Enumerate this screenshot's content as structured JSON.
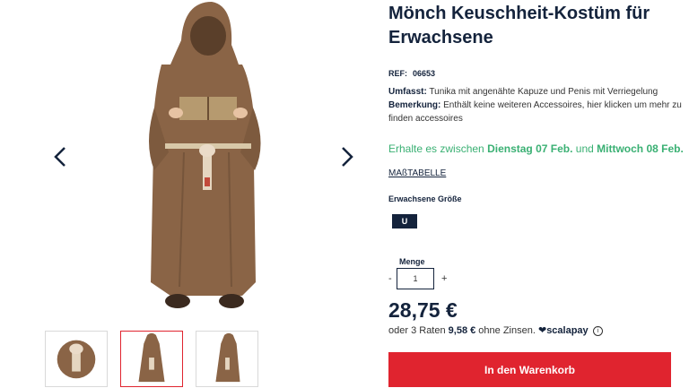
{
  "product": {
    "title": "Mönch Keuschheit-Kostüm für Erwachsene",
    "ref_label": "REF:",
    "ref_value": "06653",
    "umfasst_label": "Umfasst:",
    "umfasst_text": " Tunika mit angenähte Kapuze und Penis mit Verriegelung",
    "bemerkung_label": "Bemerkung:",
    "bemerkung_text": " Enthält keine weiteren Accessoires, hier klicken um mehr zu finden accessoires"
  },
  "delivery": {
    "prefix": "Erhalte es zwischen ",
    "date1": "Dienstag 07 Feb.",
    "middle": " und ",
    "date2": "Mittwoch 08 Feb."
  },
  "size_chart_label": "MAßTABELLE",
  "size": {
    "label": "Erwachsene Größe",
    "selected": "U"
  },
  "quantity": {
    "label": "Menge",
    "value": "1",
    "minus": "-",
    "plus": "+"
  },
  "price": "28,75 €",
  "installment": {
    "prefix": "oder 3 Raten ",
    "amount": "9,58 €",
    "suffix": " ohne Zinsen. ",
    "provider": "scalapay",
    "info": "i"
  },
  "cart_button": "In den Warenkorb",
  "colors": {
    "navy": "#14233c",
    "red": "#e0242f",
    "green": "#3ab073",
    "robe": "#8a6446"
  },
  "icons": {
    "prev": "chevron-left-icon",
    "next": "chevron-right-icon",
    "heart": "heart-icon",
    "info": "info-icon"
  }
}
